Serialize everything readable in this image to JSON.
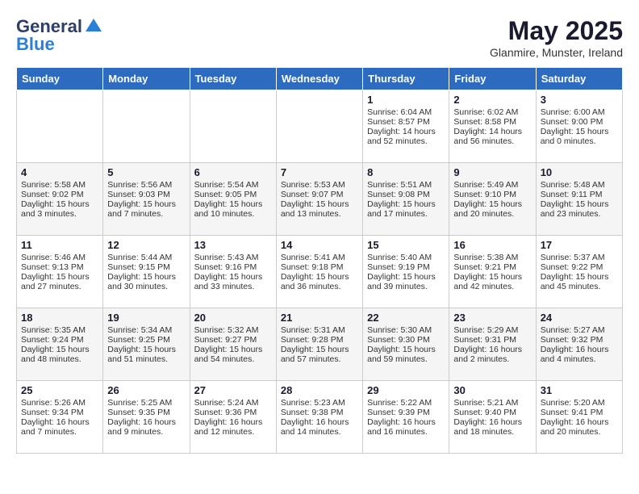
{
  "header": {
    "logo": {
      "general": "General",
      "blue": "Blue"
    },
    "title": "May 2025",
    "location": "Glanmire, Munster, Ireland"
  },
  "days_of_week": [
    "Sunday",
    "Monday",
    "Tuesday",
    "Wednesday",
    "Thursday",
    "Friday",
    "Saturday"
  ],
  "weeks": [
    [
      {
        "day": "",
        "content": ""
      },
      {
        "day": "",
        "content": ""
      },
      {
        "day": "",
        "content": ""
      },
      {
        "day": "",
        "content": ""
      },
      {
        "day": "1",
        "content": "Sunrise: 6:04 AM\nSunset: 8:57 PM\nDaylight: 14 hours\nand 52 minutes."
      },
      {
        "day": "2",
        "content": "Sunrise: 6:02 AM\nSunset: 8:58 PM\nDaylight: 14 hours\nand 56 minutes."
      },
      {
        "day": "3",
        "content": "Sunrise: 6:00 AM\nSunset: 9:00 PM\nDaylight: 15 hours\nand 0 minutes."
      }
    ],
    [
      {
        "day": "4",
        "content": "Sunrise: 5:58 AM\nSunset: 9:02 PM\nDaylight: 15 hours\nand 3 minutes."
      },
      {
        "day": "5",
        "content": "Sunrise: 5:56 AM\nSunset: 9:03 PM\nDaylight: 15 hours\nand 7 minutes."
      },
      {
        "day": "6",
        "content": "Sunrise: 5:54 AM\nSunset: 9:05 PM\nDaylight: 15 hours\nand 10 minutes."
      },
      {
        "day": "7",
        "content": "Sunrise: 5:53 AM\nSunset: 9:07 PM\nDaylight: 15 hours\nand 13 minutes."
      },
      {
        "day": "8",
        "content": "Sunrise: 5:51 AM\nSunset: 9:08 PM\nDaylight: 15 hours\nand 17 minutes."
      },
      {
        "day": "9",
        "content": "Sunrise: 5:49 AM\nSunset: 9:10 PM\nDaylight: 15 hours\nand 20 minutes."
      },
      {
        "day": "10",
        "content": "Sunrise: 5:48 AM\nSunset: 9:11 PM\nDaylight: 15 hours\nand 23 minutes."
      }
    ],
    [
      {
        "day": "11",
        "content": "Sunrise: 5:46 AM\nSunset: 9:13 PM\nDaylight: 15 hours\nand 27 minutes."
      },
      {
        "day": "12",
        "content": "Sunrise: 5:44 AM\nSunset: 9:15 PM\nDaylight: 15 hours\nand 30 minutes."
      },
      {
        "day": "13",
        "content": "Sunrise: 5:43 AM\nSunset: 9:16 PM\nDaylight: 15 hours\nand 33 minutes."
      },
      {
        "day": "14",
        "content": "Sunrise: 5:41 AM\nSunset: 9:18 PM\nDaylight: 15 hours\nand 36 minutes."
      },
      {
        "day": "15",
        "content": "Sunrise: 5:40 AM\nSunset: 9:19 PM\nDaylight: 15 hours\nand 39 minutes."
      },
      {
        "day": "16",
        "content": "Sunrise: 5:38 AM\nSunset: 9:21 PM\nDaylight: 15 hours\nand 42 minutes."
      },
      {
        "day": "17",
        "content": "Sunrise: 5:37 AM\nSunset: 9:22 PM\nDaylight: 15 hours\nand 45 minutes."
      }
    ],
    [
      {
        "day": "18",
        "content": "Sunrise: 5:35 AM\nSunset: 9:24 PM\nDaylight: 15 hours\nand 48 minutes."
      },
      {
        "day": "19",
        "content": "Sunrise: 5:34 AM\nSunset: 9:25 PM\nDaylight: 15 hours\nand 51 minutes."
      },
      {
        "day": "20",
        "content": "Sunrise: 5:32 AM\nSunset: 9:27 PM\nDaylight: 15 hours\nand 54 minutes."
      },
      {
        "day": "21",
        "content": "Sunrise: 5:31 AM\nSunset: 9:28 PM\nDaylight: 15 hours\nand 57 minutes."
      },
      {
        "day": "22",
        "content": "Sunrise: 5:30 AM\nSunset: 9:30 PM\nDaylight: 15 hours\nand 59 minutes."
      },
      {
        "day": "23",
        "content": "Sunrise: 5:29 AM\nSunset: 9:31 PM\nDaylight: 16 hours\nand 2 minutes."
      },
      {
        "day": "24",
        "content": "Sunrise: 5:27 AM\nSunset: 9:32 PM\nDaylight: 16 hours\nand 4 minutes."
      }
    ],
    [
      {
        "day": "25",
        "content": "Sunrise: 5:26 AM\nSunset: 9:34 PM\nDaylight: 16 hours\nand 7 minutes."
      },
      {
        "day": "26",
        "content": "Sunrise: 5:25 AM\nSunset: 9:35 PM\nDaylight: 16 hours\nand 9 minutes."
      },
      {
        "day": "27",
        "content": "Sunrise: 5:24 AM\nSunset: 9:36 PM\nDaylight: 16 hours\nand 12 minutes."
      },
      {
        "day": "28",
        "content": "Sunrise: 5:23 AM\nSunset: 9:38 PM\nDaylight: 16 hours\nand 14 minutes."
      },
      {
        "day": "29",
        "content": "Sunrise: 5:22 AM\nSunset: 9:39 PM\nDaylight: 16 hours\nand 16 minutes."
      },
      {
        "day": "30",
        "content": "Sunrise: 5:21 AM\nSunset: 9:40 PM\nDaylight: 16 hours\nand 18 minutes."
      },
      {
        "day": "31",
        "content": "Sunrise: 5:20 AM\nSunset: 9:41 PM\nDaylight: 16 hours\nand 20 minutes."
      }
    ]
  ]
}
